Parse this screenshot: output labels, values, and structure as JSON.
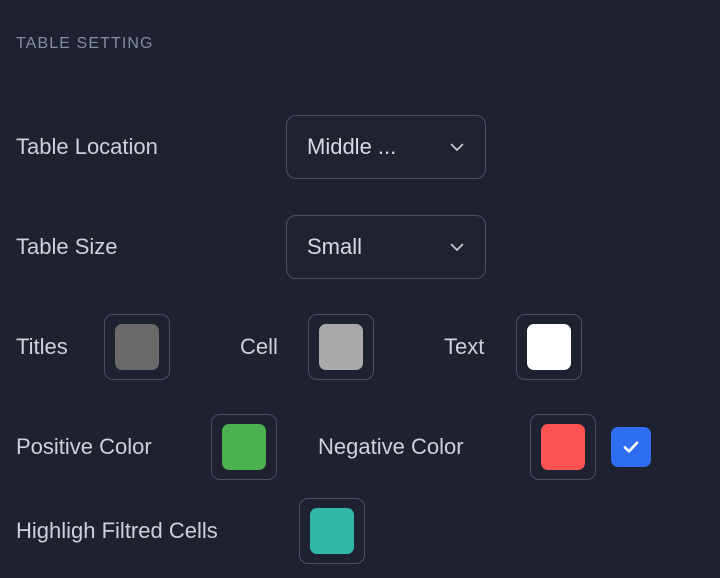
{
  "section": {
    "title": "TABLE SETTING"
  },
  "rows": {
    "table_location": {
      "label": "Table Location",
      "dropdown": {
        "value": "Middle ...",
        "icon": "chevron-down-icon"
      }
    },
    "table_size": {
      "label": "Table Size",
      "dropdown": {
        "value": "Small",
        "icon": "chevron-down-icon"
      }
    },
    "titles": {
      "label": "Titles",
      "color": "#696969"
    },
    "cell": {
      "label": "Cell",
      "color": "#a9a9a9"
    },
    "text": {
      "label": "Text",
      "color": "#ffffff"
    },
    "positive_color": {
      "label": "Positive Color",
      "color": "#4caf50"
    },
    "negative_color": {
      "label": "Negative Color",
      "color": "#fb5252",
      "checkbox": {
        "checked": true,
        "accent": "#2f6ef0",
        "icon": "check-icon"
      }
    },
    "highlight_filtered_cells": {
      "label": "Highligh Filtred Cells",
      "color": "#31b8a8"
    }
  },
  "theme": {
    "background": "#1d2130",
    "label_color": "#ccd1dd",
    "header_color": "#878da0",
    "border_color": "#4a5062"
  }
}
